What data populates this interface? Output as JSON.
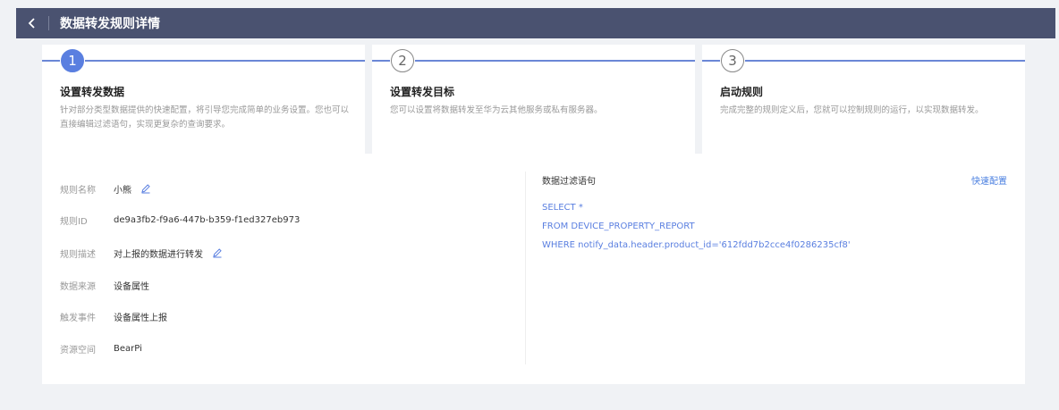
{
  "header": {
    "title": "数据转发规则详情"
  },
  "steps": [
    {
      "number": "1",
      "title": "设置转发数据",
      "desc": "针对部分类型数据提供的快速配置，将引导您完成简单的业务设置。您也可以直接编辑过滤语句，实现更复杂的查询要求。"
    },
    {
      "number": "2",
      "title": "设置转发目标",
      "desc": "您可以设置将数据转发至华为云其他服务或私有服务器。"
    },
    {
      "number": "3",
      "title": "启动规则",
      "desc": "完成完整的规则定义后，您就可以控制规则的运行，以实现数据转发。"
    }
  ],
  "fields": {
    "rule_name": {
      "label": "规则名称",
      "value": "小熊"
    },
    "rule_id": {
      "label": "规则ID",
      "value": "de9a3fb2-f9a6-447b-b359-f1ed327eb973"
    },
    "rule_desc": {
      "label": "规则描述",
      "value": "对上报的数据进行转发"
    },
    "data_source": {
      "label": "数据来源",
      "value": "设备属性"
    },
    "trigger_event": {
      "label": "触发事件",
      "value": "设备属性上报"
    },
    "resource_space": {
      "label": "资源空间",
      "value": "BearPi"
    }
  },
  "sql": {
    "title": "数据过滤语句",
    "quick_config": "快速配置",
    "lines": [
      "SELECT *",
      "FROM DEVICE_PROPERTY_REPORT",
      "WHERE notify_data.header.product_id='612fdd7b2cce4f0286235cf8'"
    ]
  },
  "colors": {
    "header_bg": "#4a5270",
    "accent": "#5a7fe0"
  }
}
